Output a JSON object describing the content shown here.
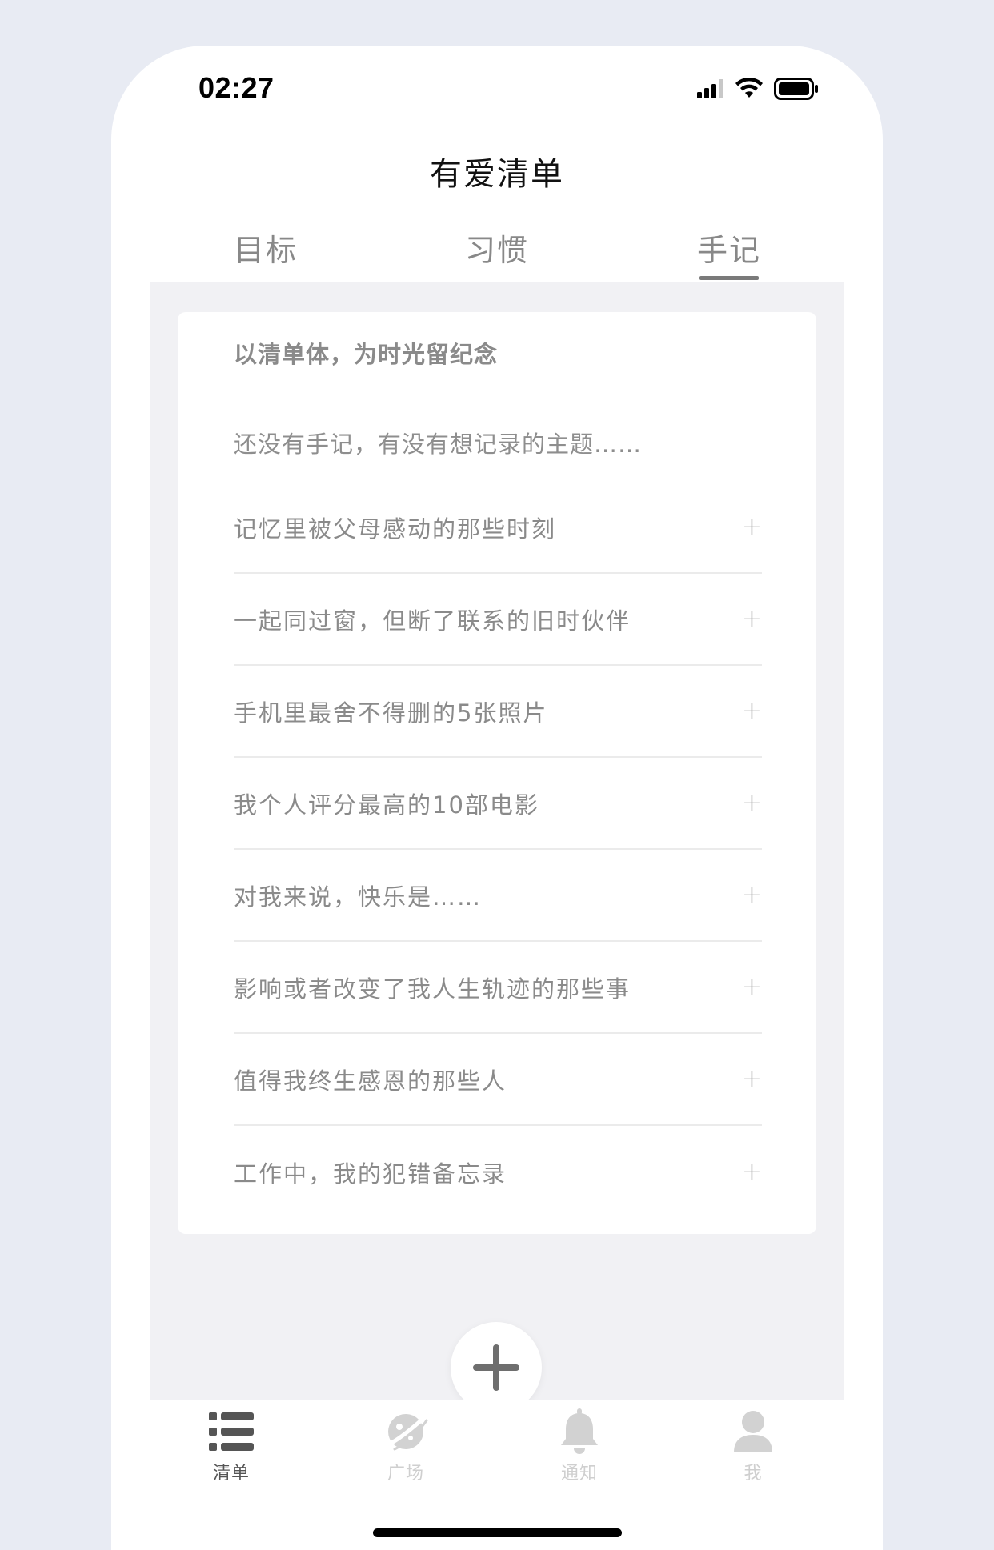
{
  "status_bar": {
    "time": "02:27"
  },
  "app": {
    "title": "有爱清单"
  },
  "tabs": [
    {
      "label": "目标",
      "active": false
    },
    {
      "label": "习惯",
      "active": false
    },
    {
      "label": "手记",
      "active": true
    }
  ],
  "card": {
    "heading": "以清单体，为时光留纪念",
    "empty_text": "还没有手记，有没有想记录的主题……",
    "items": [
      {
        "label": "记忆里被父母感动的那些时刻",
        "action": "+"
      },
      {
        "label": "一起同过窗，但断了联系的旧时伙伴",
        "action": "+"
      },
      {
        "label": "手机里最舍不得删的5张照片",
        "action": "+"
      },
      {
        "label": "我个人评分最高的10部电影",
        "action": "+"
      },
      {
        "label": "对我来说，快乐是……",
        "action": "+"
      },
      {
        "label": "影响或者改变了我人生轨迹的那些事",
        "action": "+"
      },
      {
        "label": "值得我终生感恩的那些人",
        "action": "+"
      },
      {
        "label": "工作中，我的犯错备忘录",
        "action": "+"
      }
    ]
  },
  "bottom_nav": [
    {
      "label": "清单",
      "icon": "list-icon",
      "active": true
    },
    {
      "label": "广场",
      "icon": "planet-icon",
      "active": false
    },
    {
      "label": "通知",
      "icon": "bell-icon",
      "active": false
    },
    {
      "label": "我",
      "icon": "person-icon",
      "active": false
    }
  ],
  "colors": {
    "page_bg": "#E8EBF3",
    "content_bg": "#F1F1F4",
    "active_nav": "#555555",
    "inactive_nav": "#CFCFCF",
    "text_muted": "#8A8A8A"
  }
}
